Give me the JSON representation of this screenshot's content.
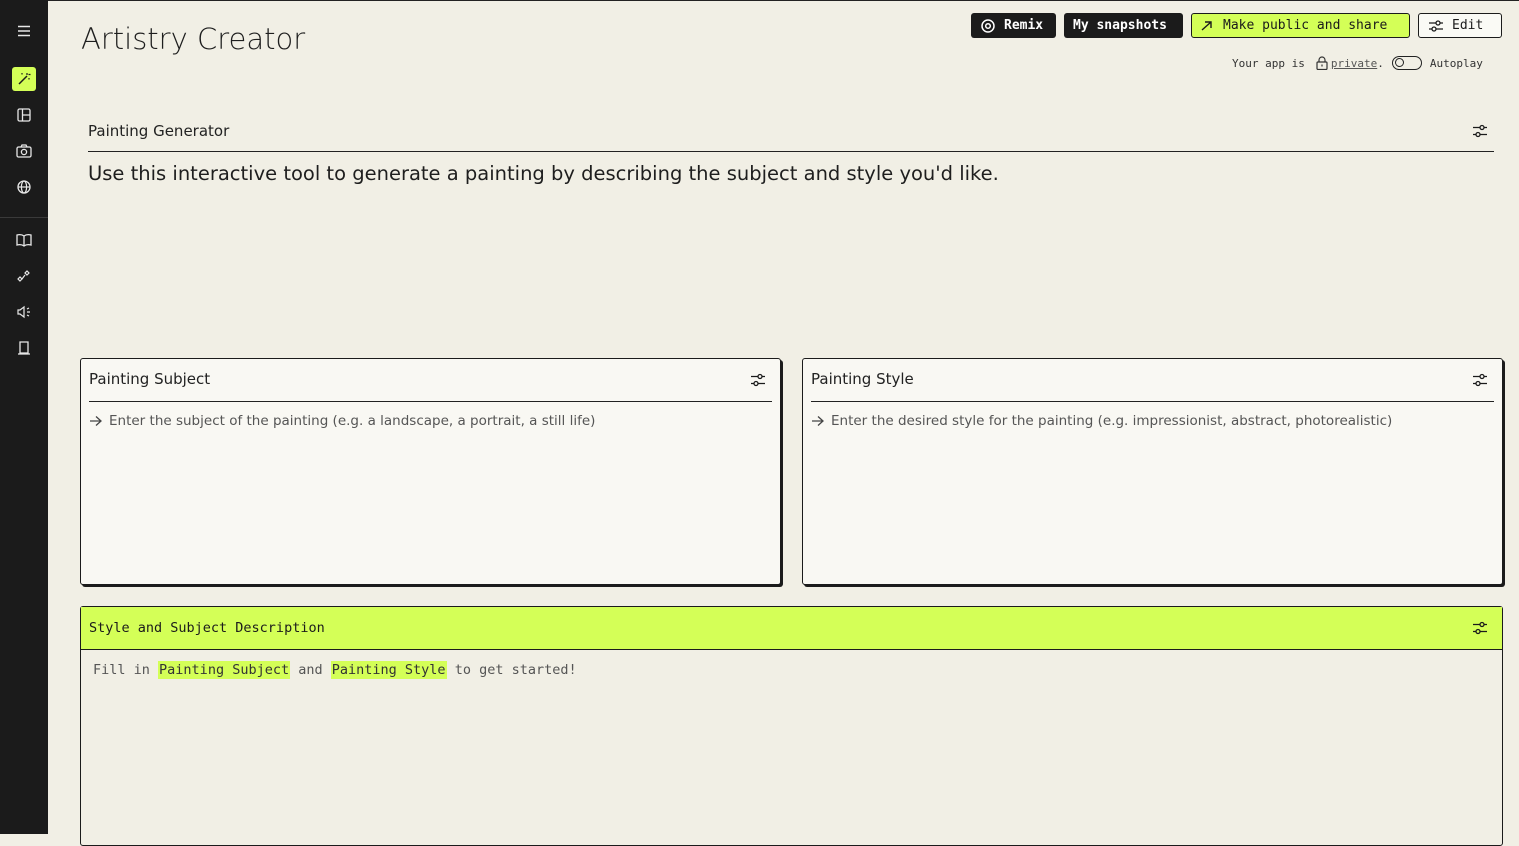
{
  "app": {
    "title": "Artistry Creator"
  },
  "toolbar": {
    "remix_label": "Remix",
    "snapshots_label": "My snapshots",
    "share_label": "Make public and share",
    "edit_label": "Edit"
  },
  "status": {
    "prefix": "Your app is",
    "privacy": "private",
    "suffix": ".",
    "autoplay_label": "Autoplay",
    "autoplay_on": false
  },
  "sidebar": {
    "icons": [
      "menu-icon",
      "magic-wand-icon",
      "layout-icon",
      "camera-icon",
      "globe-icon",
      "book-icon",
      "sparkles-icon",
      "megaphone-icon",
      "bookmark-icon"
    ]
  },
  "generator": {
    "title": "Painting Generator",
    "description": "Use this interactive tool to generate a painting by describing the subject and style you'd like."
  },
  "subject_card": {
    "title": "Painting Subject",
    "placeholder": "Enter the subject of the painting (e.g. a landscape, a portrait, a still life)"
  },
  "style_card": {
    "title": "Painting Style",
    "placeholder": "Enter the desired style for the painting (e.g. impressionist, abstract, photorealistic)"
  },
  "description_card": {
    "title": "Style and Subject Description",
    "body_prefix": "Fill in",
    "ref1": "Painting Subject",
    "body_mid": "and",
    "ref2": "Painting Style",
    "body_suffix": "to get started!"
  },
  "colors": {
    "accent": "#d4ff57",
    "sidebar": "#1b1b1b",
    "background": "#f1efe5"
  }
}
